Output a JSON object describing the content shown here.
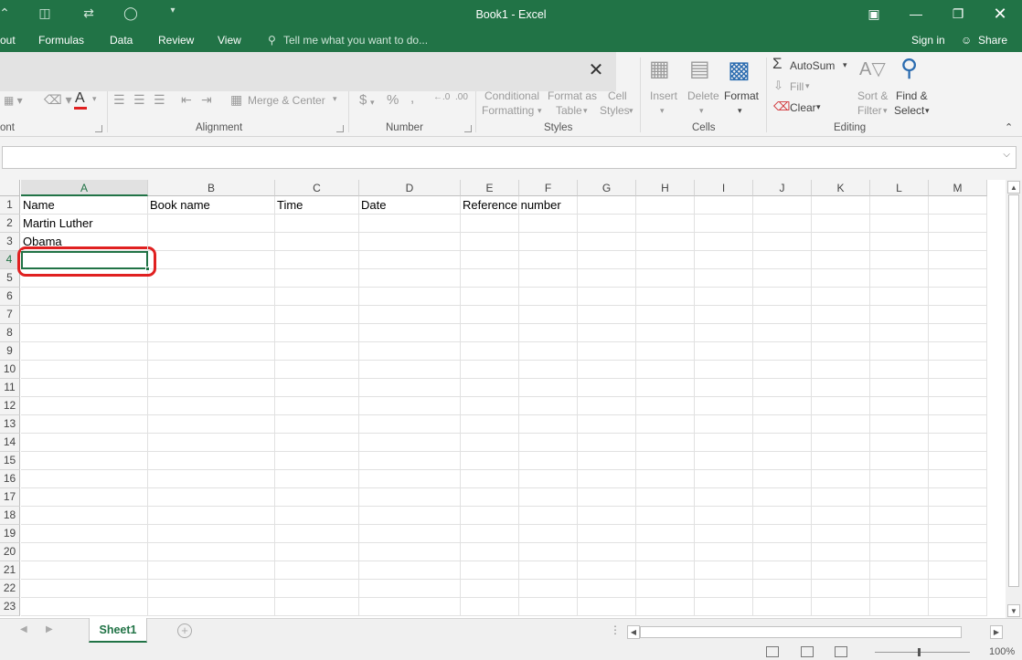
{
  "titlebar": {
    "title": "Book1 - Excel",
    "qat": [
      "caret-up-icon",
      "save-icon",
      "undo-icon",
      "redo-icon",
      "customize-icon"
    ]
  },
  "tabs": {
    "layout_partial": "out",
    "formulas": "Formulas",
    "data": "Data",
    "review": "Review",
    "view": "View",
    "tell_me": "Tell me what you want to do...",
    "sign_in": "Sign in",
    "share": "Share"
  },
  "ribbon": {
    "font_group_partial": "ont",
    "alignment": {
      "merge_center": "Merge & Center",
      "label": "Alignment"
    },
    "number": {
      "currency": "$",
      "percent": "%",
      "comma": ",",
      "label": "Number"
    },
    "styles": {
      "conditional_line1": "Conditional",
      "conditional_line2": "Formatting",
      "format_as_line1": "Format as",
      "format_as_line2": "Table",
      "cell_line1": "Cell",
      "cell_line2": "Styles",
      "label": "Styles"
    },
    "cells": {
      "insert": "Insert",
      "delete": "Delete",
      "format": "Format",
      "label": "Cells"
    },
    "editing": {
      "autosum": "AutoSum",
      "fill": "Fill",
      "clear": "Clear",
      "sort_line1": "Sort &",
      "sort_line2": "Filter",
      "find_line1": "Find &",
      "find_line2": "Select",
      "label": "Editing"
    }
  },
  "grid": {
    "columns": [
      "A",
      "B",
      "C",
      "D",
      "E",
      "F",
      "G",
      "H",
      "I",
      "J",
      "K",
      "L",
      "M"
    ],
    "rows": [
      "1",
      "2",
      "3",
      "4",
      "5",
      "6",
      "7",
      "8",
      "9",
      "10",
      "11",
      "12",
      "13",
      "14",
      "15",
      "16",
      "17",
      "18",
      "19",
      "20",
      "21",
      "22",
      "23"
    ],
    "cells": {
      "A1": "Name",
      "B1": "Book name",
      "C1": "Time",
      "D1": "Date",
      "E1": "Reference number",
      "A2": "Martin Luther",
      "A3": "Obama"
    },
    "selected_cell": "A4"
  },
  "sheets": {
    "active": "Sheet1"
  },
  "status": {
    "zoom": "100%"
  },
  "colors": {
    "excel_green": "#217346",
    "annotation_red": "#e02020"
  }
}
